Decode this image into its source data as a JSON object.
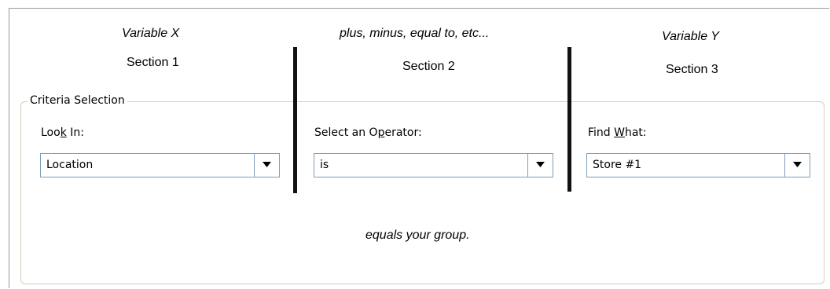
{
  "annotations": {
    "variable_x": "Variable X",
    "operator_hint": "plus, minus, equal to, etc...",
    "variable_y": "Variable Y",
    "section1": "Section 1",
    "section2": "Section 2",
    "section3": "Section 3",
    "result": "equals your group."
  },
  "criteria": {
    "group_title": "Criteria Selection",
    "look_in": {
      "label_before": "Loo",
      "label_mnemonic": "k",
      "label_after": " In:",
      "value": "Location"
    },
    "operator": {
      "label_before": "Select an O",
      "label_mnemonic": "p",
      "label_after": "erator:",
      "value": "is"
    },
    "find_what": {
      "label_before": "Find ",
      "label_mnemonic": "W",
      "label_after": "hat:",
      "value": "Store #1"
    }
  },
  "icons": {
    "dropdown": "chevron-down-icon"
  },
  "colors": {
    "groupbox_border": "#cfd3b5",
    "input_border": "#7f9db9",
    "divider": "#111111"
  }
}
